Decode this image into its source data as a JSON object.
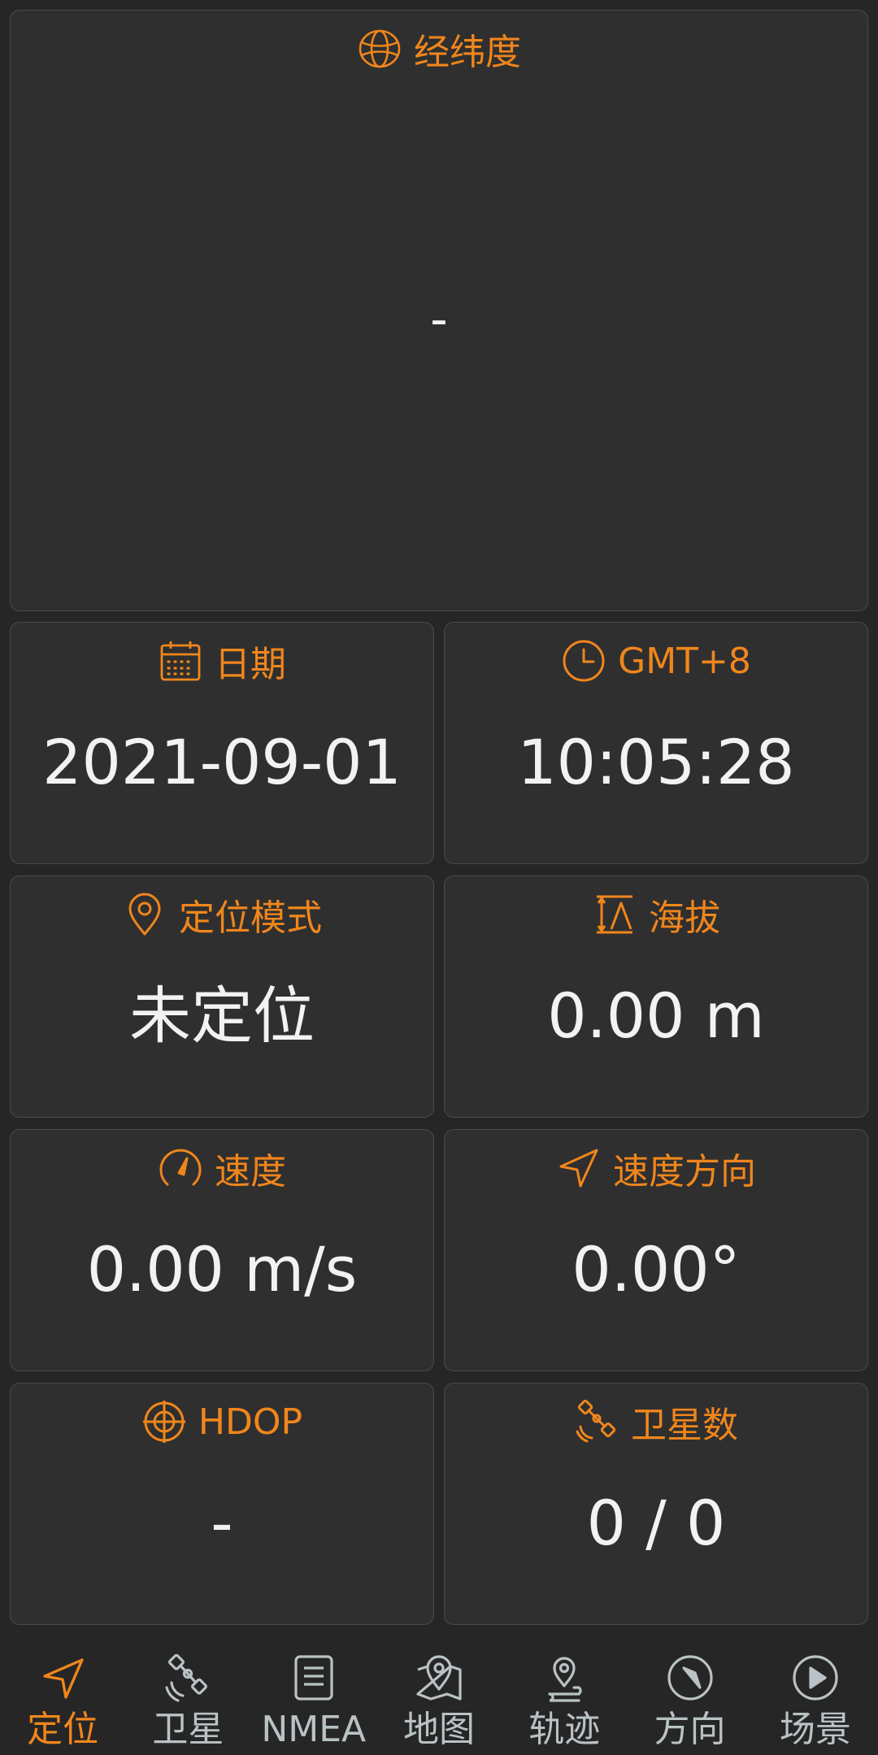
{
  "colors": {
    "accent": "#f0861c",
    "background": "#262626",
    "card": "#2f2f2f",
    "value_text": "#f2f2f2",
    "nav_inactive": "#b9c2c4"
  },
  "lat_lon": {
    "icon": "globe-icon",
    "title": "经纬度",
    "value": "-"
  },
  "date": {
    "icon": "calendar-icon",
    "title": "日期",
    "value": "2021-09-01"
  },
  "time": {
    "icon": "clock-icon",
    "title": "GMT+8",
    "value": "10:05:28"
  },
  "fix_mode": {
    "icon": "location-pin-icon",
    "title": "定位模式",
    "value": "未定位"
  },
  "altitude": {
    "icon": "altitude-icon",
    "title": "海拔",
    "value": "0.00 m"
  },
  "speed": {
    "icon": "speedometer-icon",
    "title": "速度",
    "value": "0.00 m/s"
  },
  "bearing": {
    "icon": "navigation-arrow-icon",
    "title": "速度方向",
    "value": "0.00°"
  },
  "hdop": {
    "icon": "crosshair-icon",
    "title": "HDOP",
    "value": "-"
  },
  "satellites": {
    "icon": "satellite-icon",
    "title": "卫星数",
    "value": "0 / 0"
  },
  "bottom_nav": {
    "active_index": 0,
    "items": [
      {
        "label": "定位",
        "icon": "navigation-arrow-icon"
      },
      {
        "label": "卫星",
        "icon": "satellite-icon"
      },
      {
        "label": "NMEA",
        "icon": "document-icon"
      },
      {
        "label": "地图",
        "icon": "map-pin-icon"
      },
      {
        "label": "轨迹",
        "icon": "track-pin-icon"
      },
      {
        "label": "方向",
        "icon": "compass-icon"
      },
      {
        "label": "场景",
        "icon": "play-icon"
      }
    ]
  }
}
